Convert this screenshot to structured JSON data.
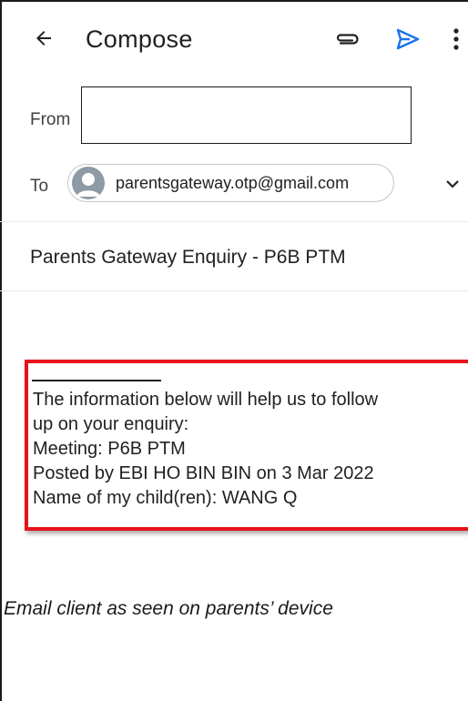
{
  "app_bar": {
    "title": "Compose",
    "icons": [
      "back-arrow-icon",
      "paperclip-icon",
      "send-icon",
      "more-vert-icon"
    ],
    "send_color": "#1a73e8"
  },
  "from": {
    "label": "From",
    "value": ""
  },
  "to": {
    "label": "To",
    "recipient": "parentsgateway.otp@gmail.com",
    "expand_icon": "chevron-down-icon"
  },
  "subject": {
    "value": "Parents Gateway Enquiry - P6B PTM"
  },
  "body": {
    "highlight_color": "#e8121a",
    "lines": [
      "The information below will help us to follow",
      "up on your enquiry:",
      "Meeting: P6B PTM",
      "Posted by EBI HO BIN BIN on 3 Mar 2022",
      "Name of my child(ren): WANG Q"
    ]
  },
  "caption": "Email client as seen on parents’ device"
}
